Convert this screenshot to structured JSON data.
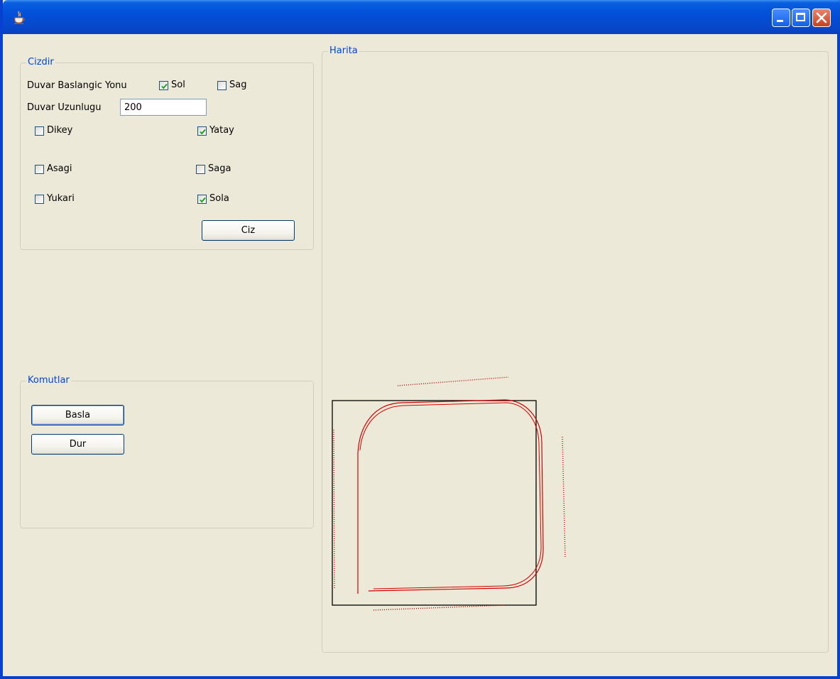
{
  "window": {
    "title": "",
    "buttons": {
      "minimize": "minimize-icon",
      "maximize": "maximize-icon",
      "close": "close-icon"
    }
  },
  "cizdir": {
    "title": "Cizdir",
    "start_direction_label": "Duvar Baslangic Yonu",
    "options": {
      "sol": {
        "label": "Sol",
        "checked": true
      },
      "sag": {
        "label": "Sag",
        "checked": false
      }
    },
    "wall_length_label": "Duvar Uzunlugu",
    "wall_length_value": "200",
    "checks": {
      "dikey": {
        "label": "Dikey",
        "checked": false
      },
      "yatay": {
        "label": "Yatay",
        "checked": true
      },
      "asagi": {
        "label": "Asagi",
        "checked": false
      },
      "saga": {
        "label": "Saga",
        "checked": false
      },
      "yukari": {
        "label": "Yukari",
        "checked": false
      },
      "sola": {
        "label": "Sola",
        "checked": true
      }
    },
    "draw_button": "Ciz"
  },
  "komutlar": {
    "title": "Komutlar",
    "start_button": "Basla",
    "stop_button": "Dur"
  },
  "harita": {
    "title": "Harita"
  },
  "colors": {
    "accent": "#0046d5",
    "path": "#dd0000",
    "background": "#ece9d8"
  }
}
